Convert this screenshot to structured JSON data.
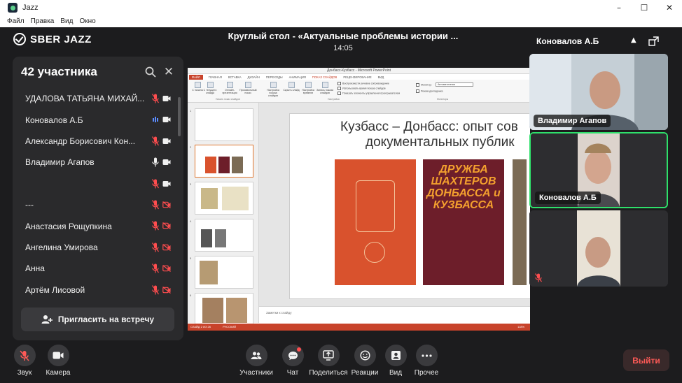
{
  "window": {
    "title": "Jazz",
    "controls": {
      "minimize": "–",
      "maximize": "☐",
      "close": "✕"
    }
  },
  "menu": [
    "Файл",
    "Правка",
    "Вид",
    "Окно"
  ],
  "app": {
    "logo_text": "SBER JAZZ"
  },
  "meeting": {
    "title": "Круглый стол - «Актуальные проблемы истории ...",
    "time": "14:05"
  },
  "participants_panel": {
    "header": "42 участника",
    "invite_label": "Пригласить на встречу",
    "items": [
      {
        "name": "УДАЛОВА ТАТЬЯНА МИХАЙ...",
        "mic": "muted",
        "cam": "on"
      },
      {
        "name": "Коновалов А.Б",
        "mic": "speaking",
        "cam": "on"
      },
      {
        "name": "Александр Борисович Кон...",
        "mic": "muted",
        "cam": "on"
      },
      {
        "name": "Владимир Агапов",
        "mic": "on",
        "cam": "on"
      },
      {
        "name": "",
        "mic": "muted",
        "cam": "on"
      },
      {
        "name": "---",
        "mic": "muted",
        "cam": "off"
      },
      {
        "name": "Анастасия Рощупкина",
        "mic": "muted",
        "cam": "off"
      },
      {
        "name": "Ангелина Умирова",
        "mic": "muted",
        "cam": "off"
      },
      {
        "name": "Анна",
        "mic": "muted",
        "cam": "off"
      },
      {
        "name": "Артём Лисовой",
        "mic": "muted",
        "cam": "off"
      }
    ]
  },
  "shared_screen": {
    "window_title": "Донбасс-Кузбасс - Microsoft PowerPoint",
    "tabs": [
      "ФАЙЛ",
      "ГЛАВНАЯ",
      "ВСТАВКА",
      "ДИЗАЙН",
      "ПЕРЕХОДЫ",
      "АНИМАЦИЯ",
      "ПОКАЗ СЛАЙДОВ",
      "РЕЦЕНЗИРОВАНИЕ",
      "ВИД"
    ],
    "active_tab": "ПОКАЗ СЛАЙДОВ",
    "ribbon_buttons": [
      "С начала",
      "С текущего слайда",
      "Онлайн-презентация",
      "Произвольный показ",
      "Настройка показа слайдов",
      "Скрыть слайд",
      "Настройка времени",
      "Запись показа слайдов"
    ],
    "ribbon_checks": [
      "Воспроизвести речевое сопровождение",
      "Использовать время показа слайдов",
      "Показать элементы управления проигрывателем"
    ],
    "monitor_label": "Монитор:",
    "monitor_value": "Автоматически",
    "presenter_check": "Режим докладчика",
    "groups": [
      "Начать показ слайдов",
      "Настройка",
      "Мониторы"
    ],
    "slide_title_line1": "Кузбасс – Донбасс: опыт сов",
    "slide_title_line2": "документальных публик",
    "notes_placeholder": "Заметки к слайду",
    "status_left": "СЛАЙД 2 ИЗ 26",
    "status_lang": "РУССКИЙ",
    "zoom": "118%",
    "book_title_2": "ДРУЖБА ШАХТЕРОВ ДОНБАССА и КУЗБАССА"
  },
  "video_panel": {
    "title": "Коновалов А.Б",
    "tiles": [
      {
        "name": "Владимир Агапов",
        "active": false
      },
      {
        "name": "Коновалов А.Б",
        "active": true
      },
      {
        "name": "",
        "active": false,
        "muted": true
      }
    ]
  },
  "toolbar": {
    "left": [
      {
        "label": "Звук",
        "icon": "mic-off-icon"
      },
      {
        "label": "Камера",
        "icon": "camera-icon"
      }
    ],
    "center": [
      {
        "label": "Участники",
        "icon": "participants-icon"
      },
      {
        "label": "Чат",
        "icon": "chat-icon"
      },
      {
        "label": "Поделиться",
        "icon": "share-screen-icon"
      },
      {
        "label": "Реакции",
        "icon": "reactions-icon"
      },
      {
        "label": "Вид",
        "icon": "layout-icon"
      },
      {
        "label": "Прочее",
        "icon": "more-icon"
      }
    ],
    "leave_label": "Выйти"
  },
  "colors": {
    "background": "#1c1c1e",
    "panel": "#2a2a2c",
    "muted_red": "#ff4d4f",
    "active_green": "#2ee06a",
    "speaking_blue": "#5b8cff",
    "leave_text": "#ff5a57"
  }
}
